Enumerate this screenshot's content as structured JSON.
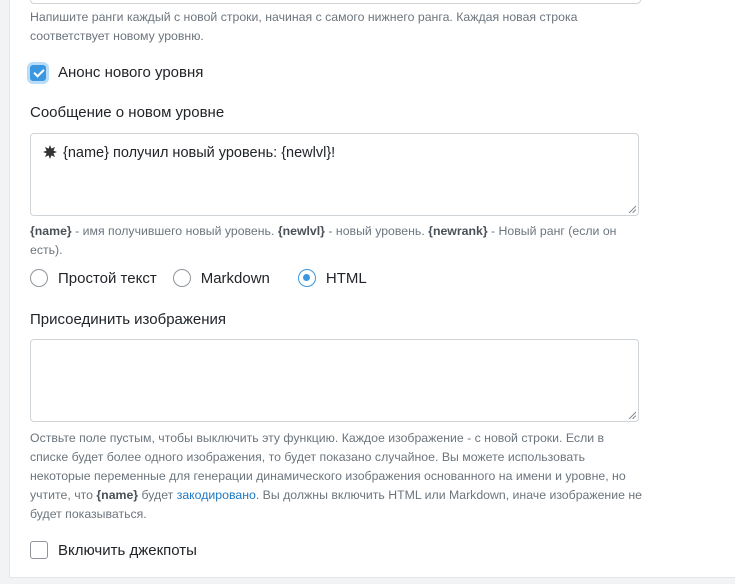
{
  "ranks_help": "Напишите ранги каждый с новой строки, начиная с самого нижнего ранга. Каждая новая строка соответствует новому уровню.",
  "announce": {
    "label": "Анонс нового уровня",
    "checked": true
  },
  "message": {
    "label": "Сообщение о новом уровне",
    "value": "{name} получил новый уровень: {newlvl}!",
    "icon": "star-burst-icon"
  },
  "vars_help": {
    "name_var": "{name}",
    "name_desc": " - имя получившего новый уровень. ",
    "newlvl_var": "{newlvl}",
    "newlvl_desc": " - новый уровень. ",
    "newrank_var": "{newrank}",
    "newrank_desc": " - Новый ранг (если он есть)."
  },
  "format": {
    "options": [
      "Простой текст",
      "Markdown",
      "HTML"
    ],
    "selected": "HTML"
  },
  "images": {
    "label": "Присоединить изображения",
    "value": "",
    "help_1": "Оствьте поле пустым, чтобы выключить эту функцию. Каждое изображение - с новой строки. Если в списке будет более одного изображения, то будет показано случайное. Вы можете использовать некоторые переменные для генерации динамического изображения основанного на имени и уровне, но учтите, что ",
    "help_var": "{name}",
    "help_2": " будет ",
    "help_link": "закодировано",
    "help_3": ". Вы должны включить HTML или Markdown, иначе изображение не будет показываться."
  },
  "jackpots": {
    "label": "Включить джекпоты",
    "checked": false
  },
  "colors": {
    "accent": "#3a97e0",
    "link": "#1f78c4",
    "help": "#6c757d"
  }
}
